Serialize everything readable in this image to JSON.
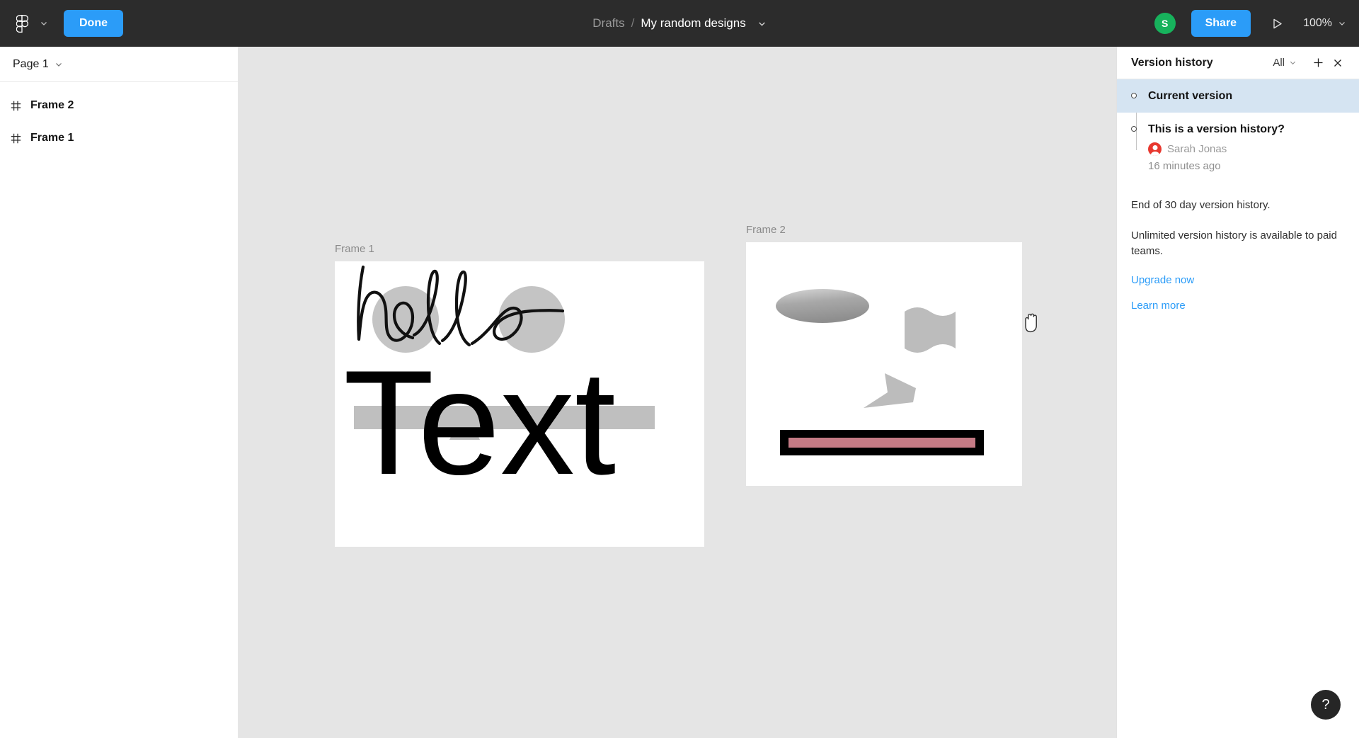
{
  "topbar": {
    "logo_icon": "figma-logo-icon",
    "menu_caret_icon": "chevron-down-icon",
    "done_label": "Done",
    "breadcrumb": {
      "root": "Drafts",
      "separator": "/",
      "file": "My random designs",
      "caret_icon": "chevron-down-icon"
    },
    "avatar_initial": "S",
    "avatar_color": "#17b25c",
    "share_label": "Share",
    "present_icon": "play-icon",
    "zoom_level": "100%",
    "zoom_caret_icon": "chevron-down-icon",
    "accent_color": "#2b9cf8",
    "bar_color": "#2c2c2c"
  },
  "sidebar": {
    "page_name": "Page 1",
    "page_caret_icon": "chevron-down-icon",
    "layers": [
      {
        "name": "Frame 2",
        "icon": "frame-hash-icon"
      },
      {
        "name": "Frame 1",
        "icon": "frame-hash-icon"
      }
    ]
  },
  "canvas": {
    "background_color": "#e5e5e5",
    "cursor_icon": "hand-grab-cursor-icon",
    "frames": [
      {
        "title": "Frame 1"
      },
      {
        "title": "Frame 2"
      }
    ],
    "frame1_shapes": {
      "circle_left_color": "#c4c4c4",
      "circle_right_color": "#c4c4c4",
      "triangle_color": "#bcbcbc",
      "bar_color": "#bfbfbf",
      "scribble_text": "hello",
      "scribble_color": "#111111",
      "big_text": "Text",
      "big_text_color": "#000000"
    },
    "frame2_shapes": {
      "ellipse_color": "#a6a6a6",
      "blob_color": "#bcbcbc",
      "arrow_color": "#bcbcbc",
      "bar_outer_color": "#000000",
      "bar_inner_color": "#c57b85"
    }
  },
  "version_panel": {
    "title": "Version history",
    "filter_label": "All",
    "filter_caret_icon": "chevron-down-icon",
    "add_icon": "plus-icon",
    "close_icon": "close-icon",
    "selected_color": "#d5e4f2",
    "entries": [
      {
        "name": "Current version",
        "author": "",
        "time": "",
        "selected": true
      },
      {
        "name": "This is a version history?",
        "author": "Sarah Jonas",
        "avatar_color": "#e8382f",
        "time": "16 minutes ago",
        "selected": false
      }
    ],
    "info_line_1": "End of 30 day version history.",
    "info_line_2": "Unlimited version history is available to paid teams.",
    "upgrade_link": "Upgrade now",
    "learn_link": "Learn more",
    "link_color": "#2b9cf8"
  },
  "help": {
    "label": "?",
    "icon": "question-mark-icon"
  }
}
